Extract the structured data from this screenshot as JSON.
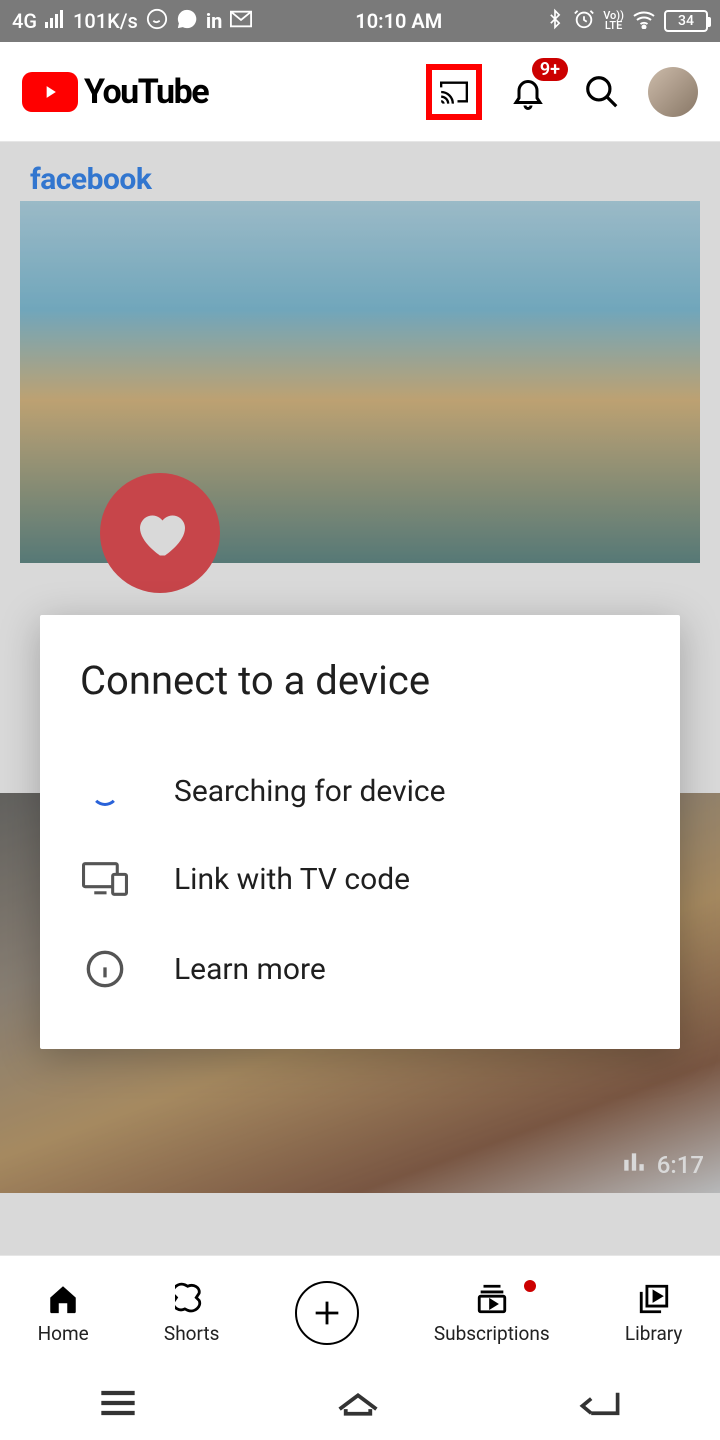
{
  "status": {
    "net": "4G",
    "speed": "101K/s",
    "time": "10:10 AM",
    "lte": "Vo))\nLTE",
    "battery": "34"
  },
  "app": {
    "brand": "YouTube",
    "badge": "9+"
  },
  "feed": {
    "sponsor": "facebook",
    "video2_duration": "6:17"
  },
  "modal": {
    "title": "Connect to a device",
    "searching": "Searching for device",
    "link_tv": "Link with TV code",
    "learn_more": "Learn more"
  },
  "nav": {
    "home": "Home",
    "shorts": "Shorts",
    "subs": "Subscriptions",
    "library": "Library"
  }
}
